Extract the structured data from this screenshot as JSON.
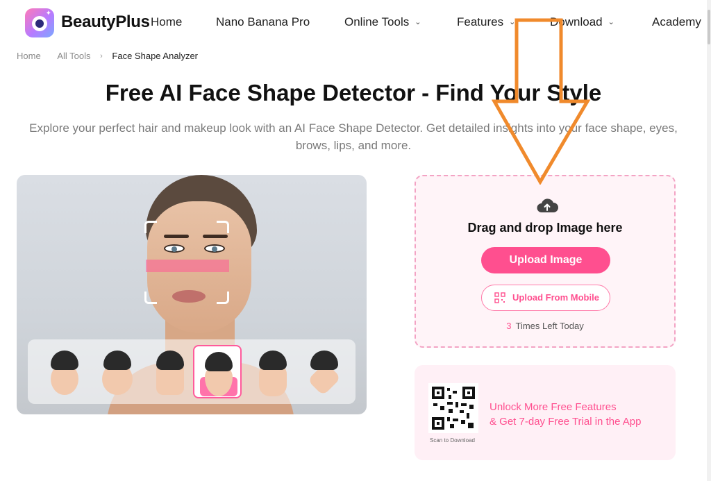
{
  "header": {
    "brand": "BeautyPlus",
    "nav": [
      {
        "label": "Home",
        "has_dropdown": false
      },
      {
        "label": "Nano Banana Pro",
        "has_dropdown": false
      },
      {
        "label": "Online Tools",
        "has_dropdown": true
      },
      {
        "label": "Features",
        "has_dropdown": true
      },
      {
        "label": "Download",
        "has_dropdown": true
      },
      {
        "label": "Academy",
        "has_dropdown": false
      }
    ]
  },
  "breadcrumb": {
    "items": [
      "Home",
      "All Tools",
      "Face Shape Analyzer"
    ]
  },
  "hero": {
    "title": "Free AI Face Shape Detector - Find Your Style",
    "subtitle": "Explore your perfect hair and makeup look with an AI Face Shape Detector. Get detailed insights into your face shape, eyes, brows, lips, and more."
  },
  "upload": {
    "icon": "cloud-upload-icon",
    "drag_text": "Drag and drop Image here",
    "upload_button": "Upload Image",
    "mobile_button": "Upload From Mobile",
    "times_count": "3",
    "times_label": "Times Left Today"
  },
  "promo": {
    "line1": "Unlock More Free Features",
    "line2": "& Get 7-day Free Trial in the App",
    "scan_label": "Scan to Download"
  },
  "colors": {
    "accent": "#ff4f8f",
    "annotation": "#f08a2c"
  }
}
